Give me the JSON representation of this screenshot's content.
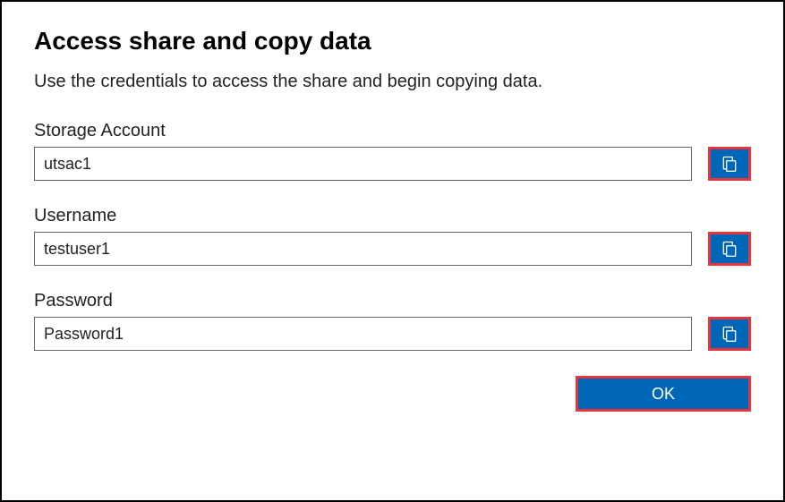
{
  "title": "Access share and copy data",
  "description": "Use the credentials to access the share and begin copying data.",
  "fields": {
    "storage_account": {
      "label": "Storage Account",
      "value": "utsac1"
    },
    "username": {
      "label": "Username",
      "value": "testuser1"
    },
    "password": {
      "label": "Password",
      "value": "Password1"
    }
  },
  "buttons": {
    "ok_label": "OK"
  }
}
